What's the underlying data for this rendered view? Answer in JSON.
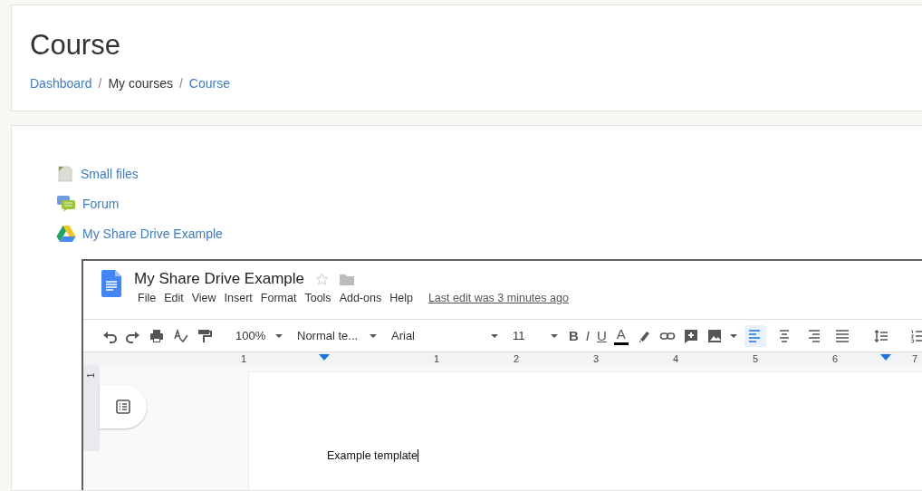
{
  "header": {
    "title": "Course",
    "separator": "/",
    "breadcrumb": [
      {
        "label": "Dashboard",
        "link": true
      },
      {
        "label": "My courses",
        "link": false
      },
      {
        "label": "Course",
        "link": true
      }
    ]
  },
  "activities": [
    {
      "name": "Small files",
      "kind": "file"
    },
    {
      "name": "Forum",
      "kind": "forum"
    },
    {
      "name": "My Share Drive Example",
      "kind": "drive"
    }
  ],
  "document": {
    "title": "My Share Drive Example",
    "starred": false,
    "menu": [
      "File",
      "Edit",
      "View",
      "Insert",
      "Format",
      "Tools",
      "Add-ons",
      "Help"
    ],
    "last_edit": "Last edit was 3 minutes ago",
    "toolbar": {
      "zoom": "100%",
      "style": "Normal te...",
      "font": "Arial",
      "size": "11",
      "format_letters": [
        "B",
        "I",
        "U",
        "A"
      ],
      "alignments": [
        {
          "selected": true
        },
        {
          "selected": false
        },
        {
          "selected": false
        },
        {
          "selected": false
        }
      ]
    },
    "ruler": [
      "1",
      "1",
      "2",
      "3",
      "4",
      "5",
      "6",
      "7"
    ],
    "vertical_ruler": "1",
    "body_text": "Example template"
  }
}
